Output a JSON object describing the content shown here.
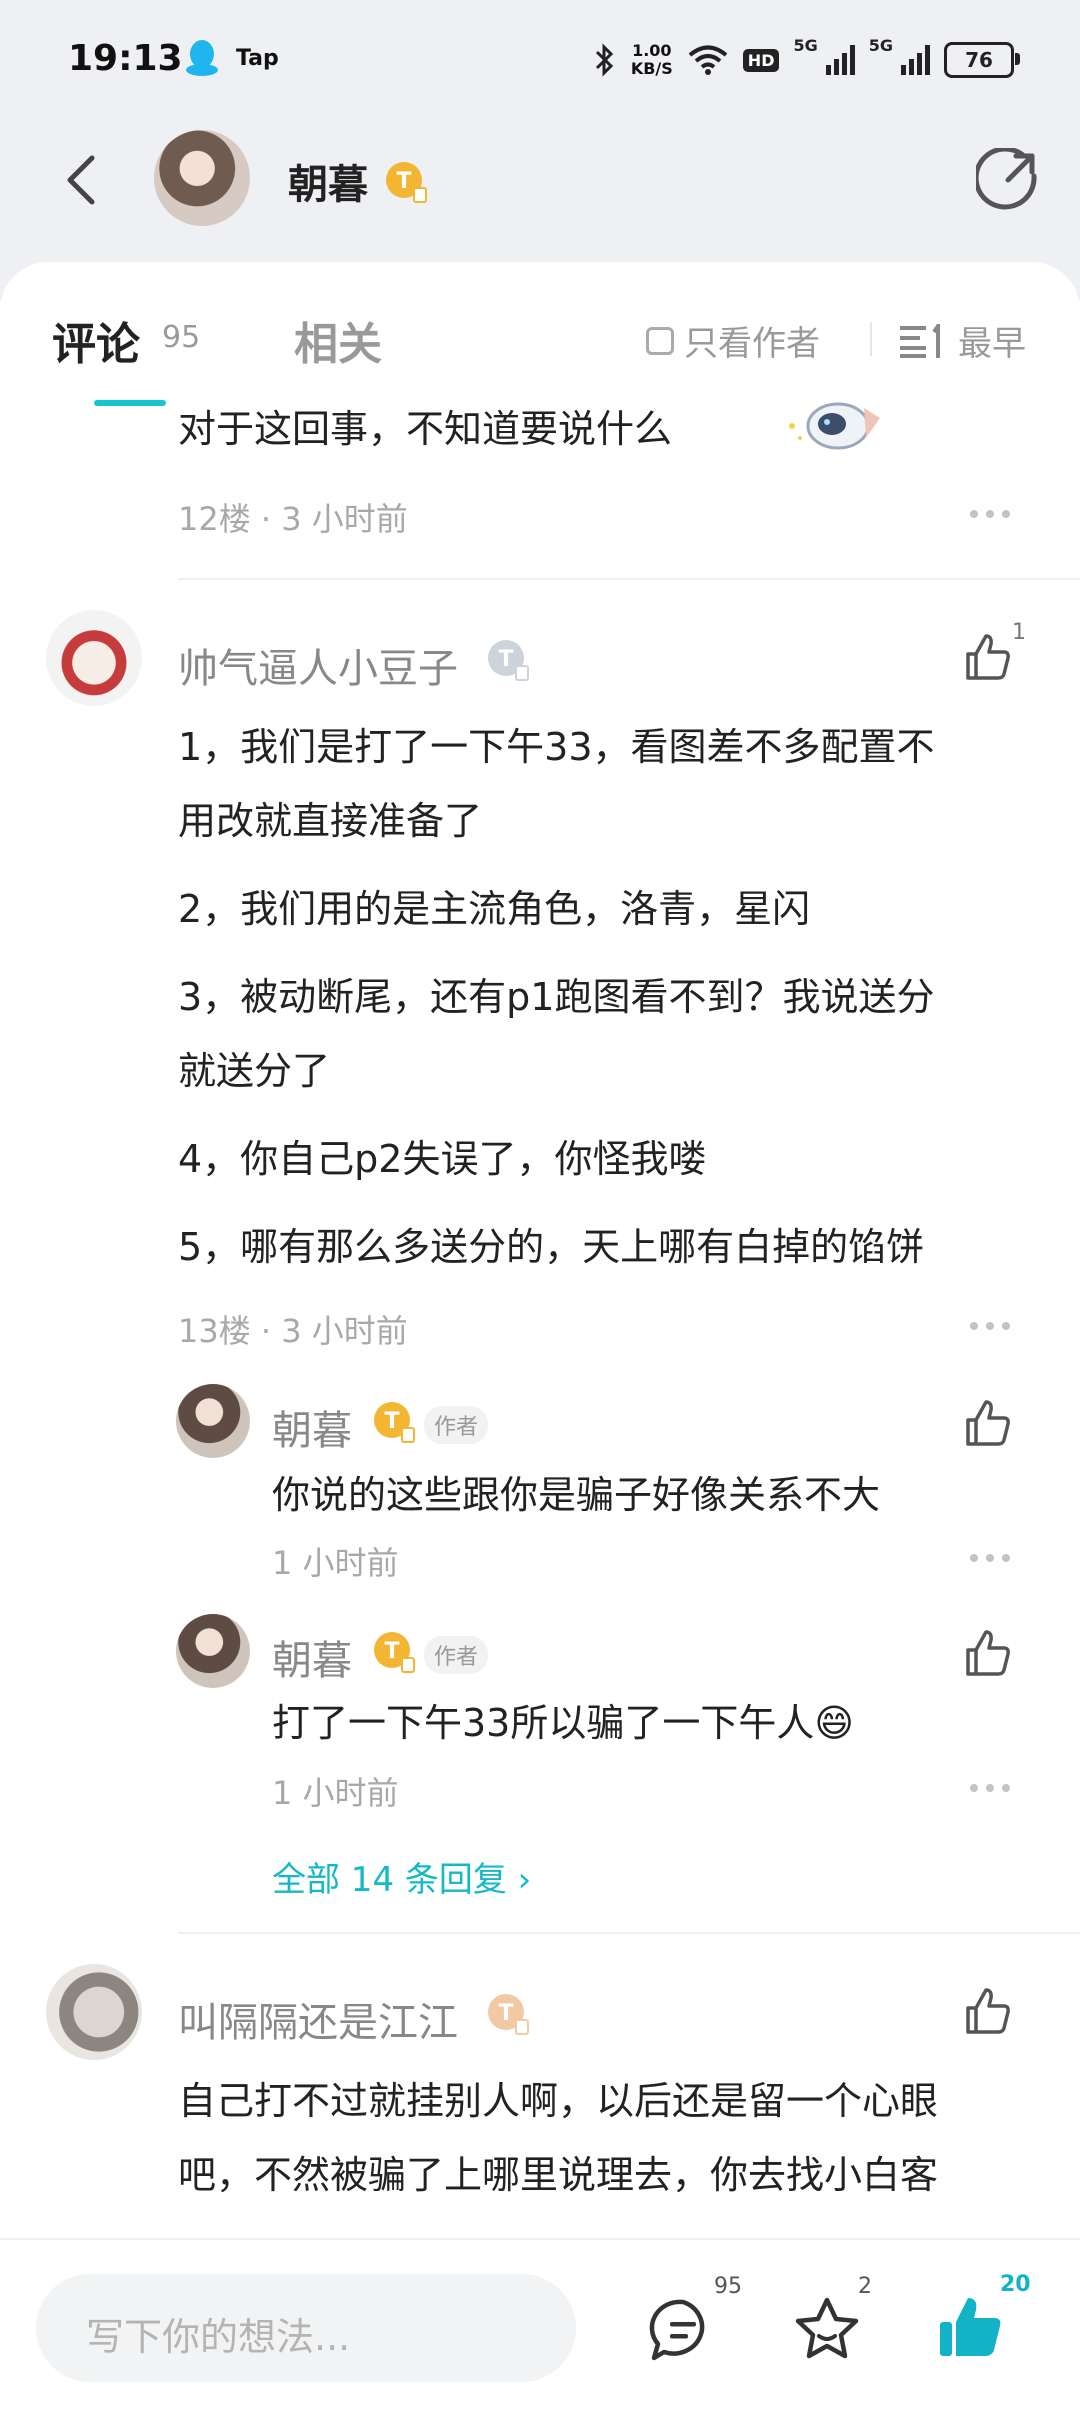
{
  "status_bar": {
    "time": "19:13",
    "app_tag": "Tap",
    "net_speed_value": "1.00",
    "net_speed_unit": "KB/S",
    "hd_label": "HD",
    "sim1_tag": "5G",
    "sim2_tag": "5G",
    "battery": "76"
  },
  "header": {
    "username": "朝暮",
    "badge": "T"
  },
  "tabs": {
    "comments_label": "评论",
    "comments_count": "95",
    "related_label": "相关",
    "only_author_label": "只看作者",
    "sort_label": "最早"
  },
  "comments": {
    "floor12": {
      "text": "对于这回事，不知道要说什么",
      "meta": "12楼 · 3 小时前"
    },
    "floor13": {
      "username": "帅气逼人小豆子",
      "badge": "T",
      "like_count": "1",
      "lines": [
        "1，我们是打了一下午33，看图差不多配置不",
        "用改就直接准备了",
        "2，我们用的是主流角色，洛青，星闪",
        "3，被动断尾，还有p1跑图看不到？我说送分",
        "就送分了",
        "4，你自己p2失误了，你怪我喽",
        "5，哪有那么多送分的，天上哪有白掉的馅饼"
      ],
      "meta": "13楼 · 3 小时前",
      "replies": [
        {
          "username": "朝暮",
          "badge": "T",
          "author_tag": "作者",
          "text": "你说的这些跟你是骗子好像关系不大",
          "time": "1 小时前"
        },
        {
          "username": "朝暮",
          "badge": "T",
          "author_tag": "作者",
          "text": "打了一下午33所以骗了一下午人😄",
          "time": "1 小时前"
        }
      ],
      "view_all": "全部 14 条回复 ›"
    },
    "floor14": {
      "username": "叫隔隔还是江江",
      "badge": "T",
      "lines": [
        "自己打不过就挂别人啊，以后还是留一个心眼",
        "吧，不然被骗了上哪里说理去，你去找小白客"
      ]
    }
  },
  "bottom_bar": {
    "placeholder": "写下你的想法...",
    "comment_count": "95",
    "favorite_count": "2",
    "like_count": "20"
  },
  "colors": {
    "accent": "#15c5ce",
    "like_active": "#12b3c7",
    "badge_gold": "#f2b632"
  }
}
